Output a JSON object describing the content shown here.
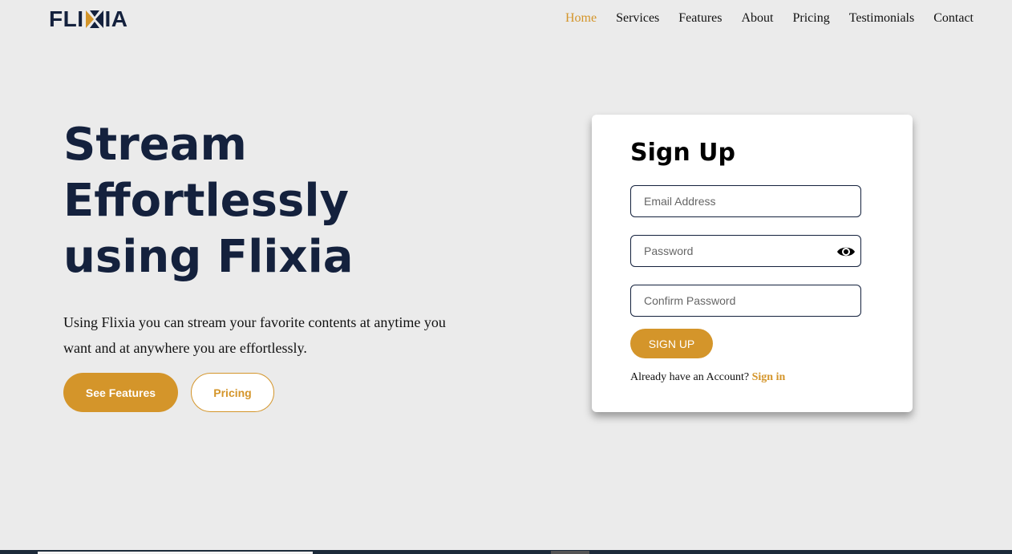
{
  "brand": {
    "name_left": "FLI",
    "name_right": "IA",
    "accent": "#d4952a",
    "primary": "#14213d"
  },
  "nav": {
    "items": [
      {
        "label": "Home",
        "active": true
      },
      {
        "label": "Services"
      },
      {
        "label": "Features"
      },
      {
        "label": "About"
      },
      {
        "label": "Pricing"
      },
      {
        "label": "Testimonials"
      },
      {
        "label": "Contact"
      }
    ]
  },
  "hero": {
    "title_lines": [
      "Stream",
      "Effortlessly",
      "using Flixia"
    ],
    "description": "Using Flixia you can stream your favorite contents at anytime you want and at anywhere you are effortlessly.",
    "features_button": "See Features",
    "pricing_button": "Pricing"
  },
  "signup": {
    "title": "Sign Up",
    "email_placeholder": "Email Address",
    "password_placeholder": "Password",
    "password_toggle_icon": "eye-icon",
    "confirm_placeholder": "Confirm Password",
    "submit_label": "SIGN UP",
    "account_prompt": "Already have an Account?",
    "signin_link": "Sign in"
  }
}
